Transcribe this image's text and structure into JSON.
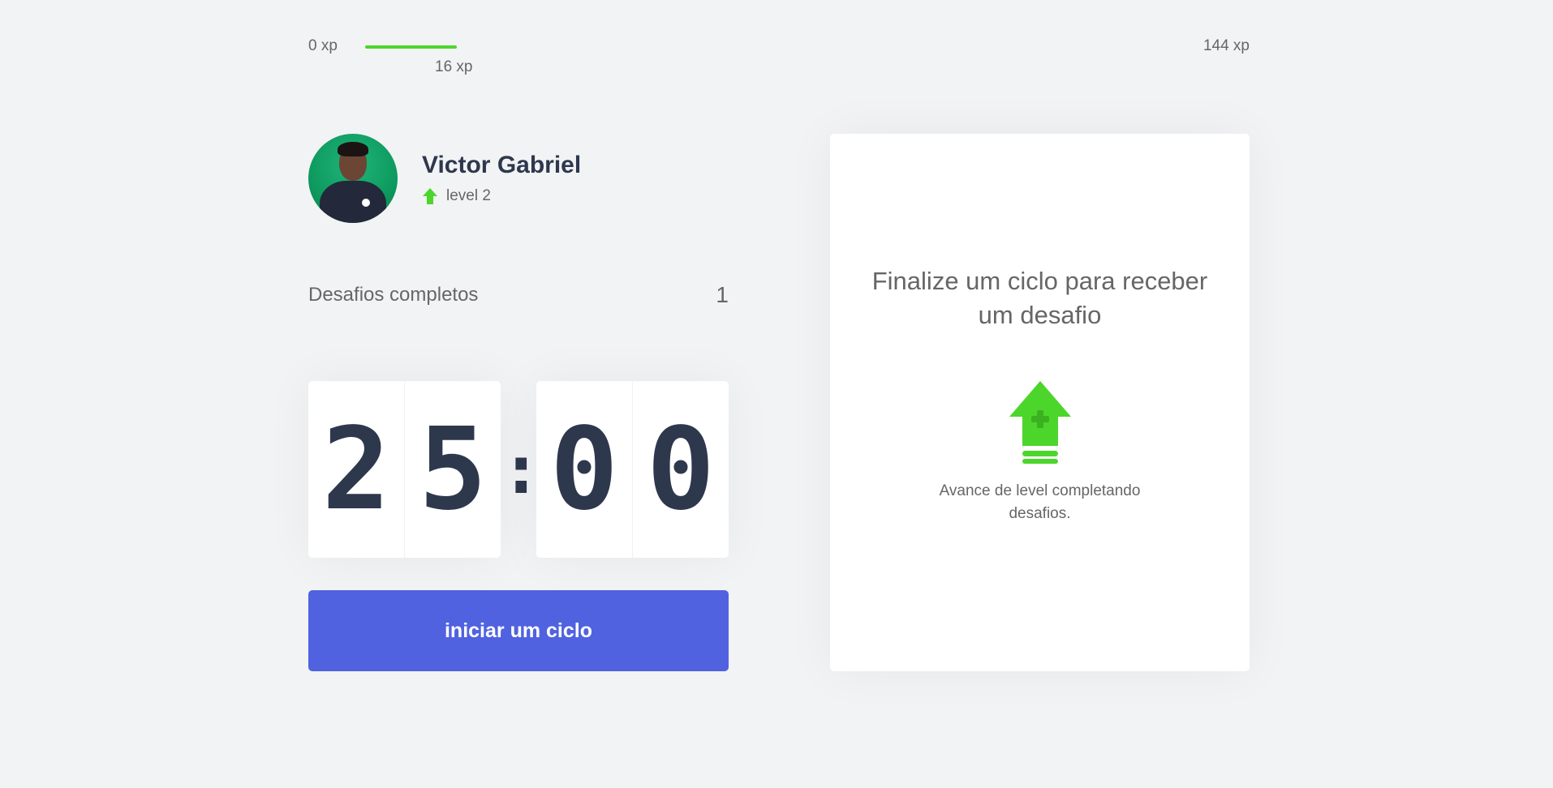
{
  "xp": {
    "min_label": "0 xp",
    "max_label": "144 xp",
    "current_label": "16 xp",
    "current_value": 16,
    "max_value": 144,
    "fill_color": "#4cd62b"
  },
  "profile": {
    "name": "Victor Gabriel",
    "level_label": "level 2",
    "level_icon": "level-up-arrow-icon"
  },
  "challenges": {
    "label": "Desafios completos",
    "count": "1"
  },
  "countdown": {
    "minute_left": "2",
    "minute_right": "5",
    "separator": ":",
    "second_left": "0",
    "second_right": "0"
  },
  "start_button": {
    "label": "iniciar um ciclo",
    "color": "#5062e0"
  },
  "challenge_box": {
    "title": "Finalize um ciclo para receber um desafio",
    "icon": "level-up-icon",
    "description": "Avance de level completando desafios."
  },
  "colors": {
    "background": "#f2f3f5",
    "text": "#666666",
    "title": "#2e384d",
    "green": "#4cd62b",
    "blue": "#5062e0"
  }
}
